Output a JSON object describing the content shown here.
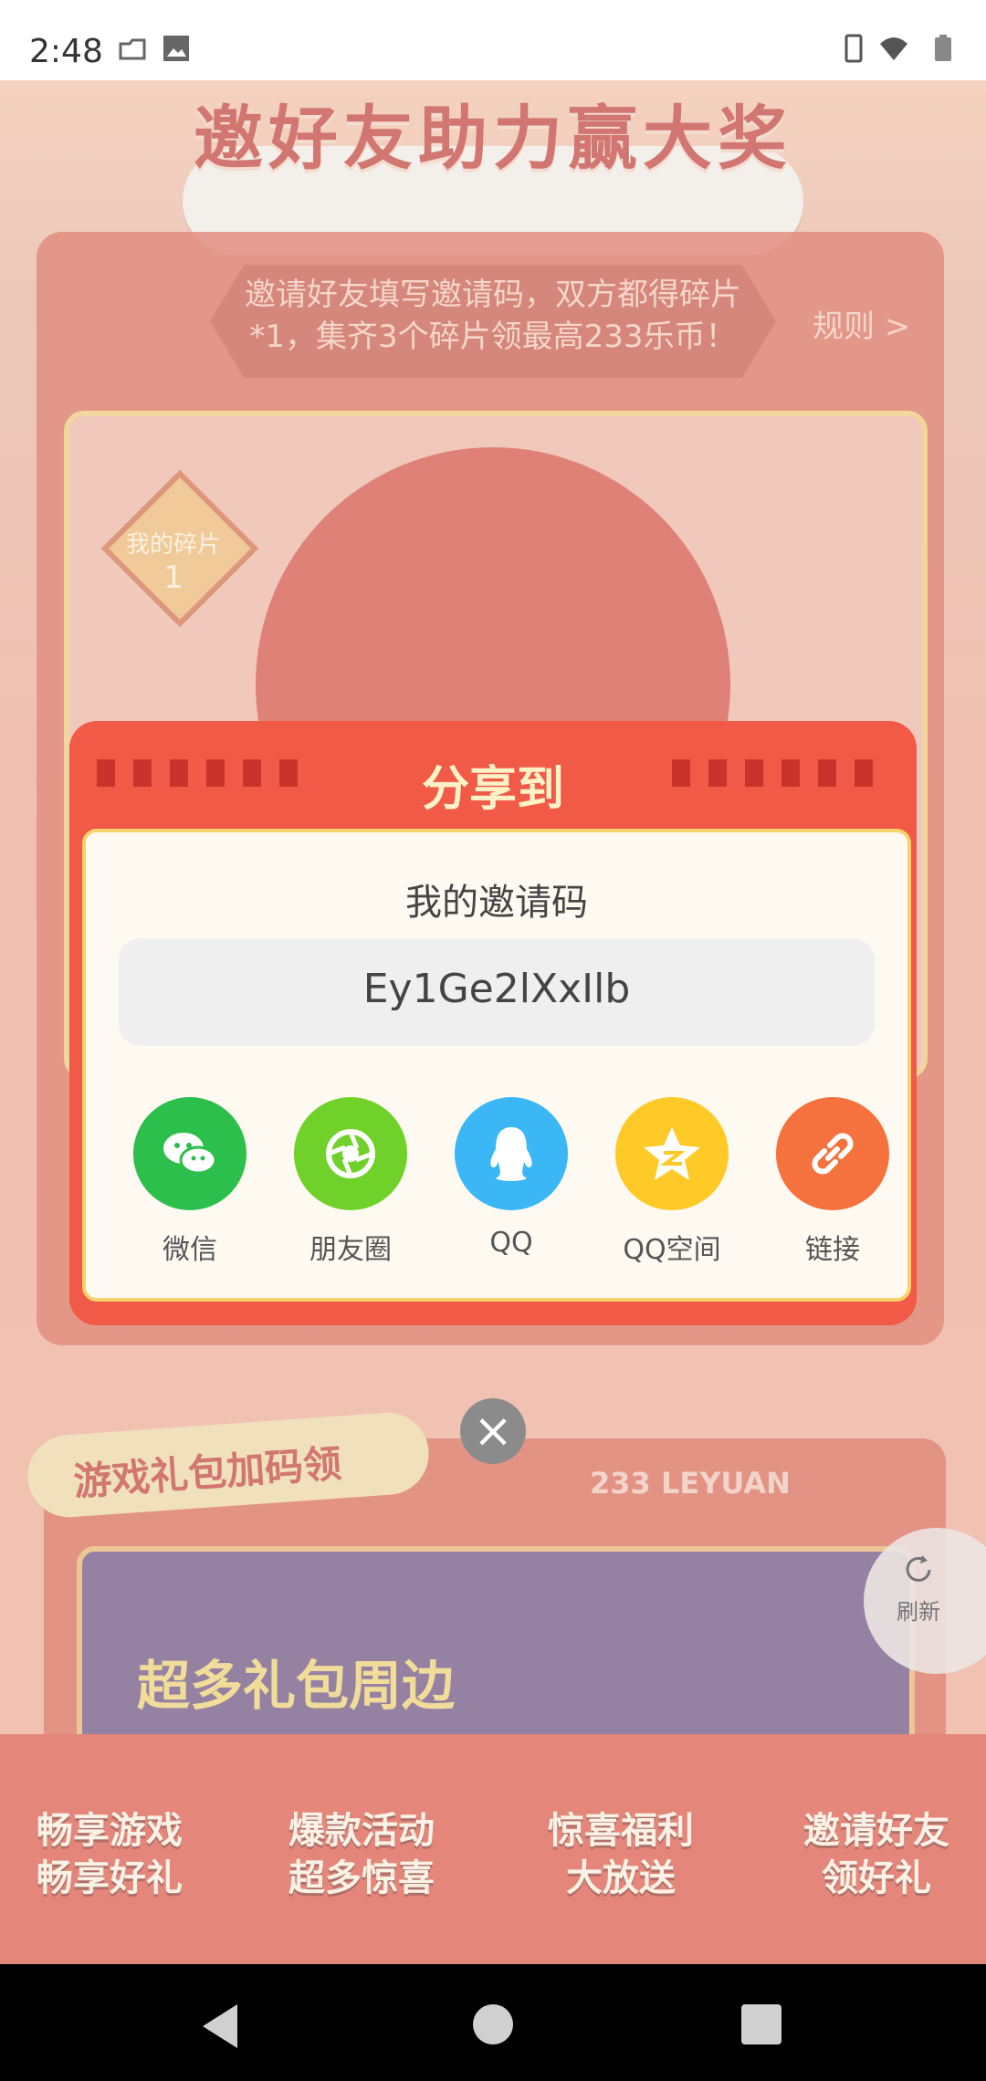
{
  "status_bar": {
    "time": "2:48"
  },
  "page": {
    "title": "邀好友助力赢大奖",
    "intro_line1": "邀请好友填写邀请码，双方都得碎片",
    "intro_line2": "*1，集齐3个碎片领最高233乐币！",
    "rules_link": "规则 >",
    "my_pieces_label": "我的碎片",
    "my_pieces_count": "1",
    "gift_section_title": "游戏礼包加码领",
    "leyuan_brand": "233 LEYUAN",
    "banner_text": "超多礼包周边",
    "refresh_label": "刷新",
    "footer_features": [
      {
        "line1": "畅享游戏",
        "line2": "畅享好礼"
      },
      {
        "line1": "爆款活动",
        "line2": "超多惊喜"
      },
      {
        "line1": "惊喜福利",
        "line2": "大放送"
      },
      {
        "line1": "邀请好友",
        "line2": "领好礼"
      }
    ]
  },
  "dialog": {
    "title": "分享到",
    "code_label": "我的邀请码",
    "invite_code": "Ey1Ge2lXxIlb",
    "share_options": [
      {
        "label": "微信",
        "icon": "wechat-icon",
        "color": "#2dbf4b"
      },
      {
        "label": "朋友圈",
        "icon": "moments-icon",
        "color": "#6fd12a"
      },
      {
        "label": "QQ",
        "icon": "qq-icon",
        "color": "#3bb7f5"
      },
      {
        "label": "QQ空间",
        "icon": "qzone-icon",
        "color": "#ffc928"
      },
      {
        "label": "链接",
        "icon": "link-icon",
        "color": "#f5723e"
      }
    ]
  }
}
